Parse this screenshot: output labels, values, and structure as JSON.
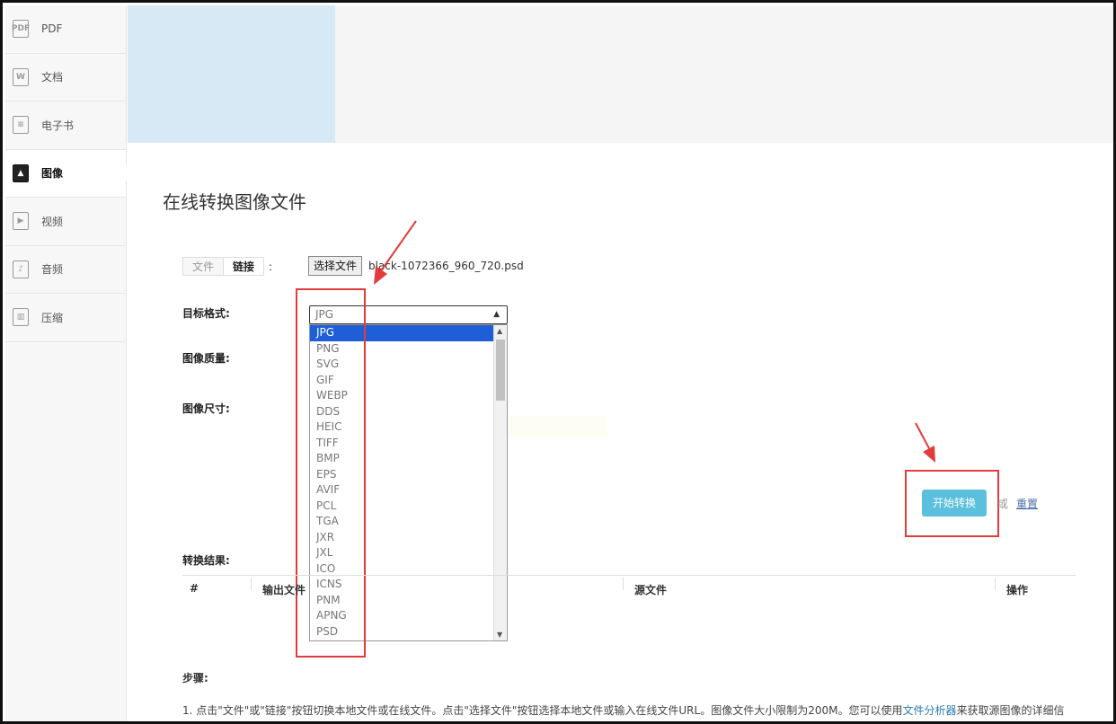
{
  "sidebar": {
    "items": [
      {
        "label": "PDF",
        "icon": "pdf-file-icon",
        "glyph": "PDF"
      },
      {
        "label": "文档",
        "icon": "word-file-icon",
        "glyph": "W"
      },
      {
        "label": "电子书",
        "icon": "ebook-icon",
        "glyph": "≡"
      },
      {
        "label": "图像",
        "icon": "image-icon",
        "glyph": "▲",
        "active": true
      },
      {
        "label": "视频",
        "icon": "video-icon",
        "glyph": "▶"
      },
      {
        "label": "音频",
        "icon": "audio-icon",
        "glyph": "♪"
      },
      {
        "label": "压缩",
        "icon": "archive-icon",
        "glyph": "▥"
      }
    ]
  },
  "page": {
    "title": "在线转换图像文件"
  },
  "source": {
    "tab_file": "文件",
    "tab_link": "链接",
    "colon": ":",
    "choose_button": "选择文件",
    "file_name": "black-1072366_960_720.psd"
  },
  "form": {
    "target_format_label": "目标格式:",
    "quality_label": "图像质量:",
    "size_label": "图像尺寸:",
    "selected_format": "JPG",
    "format_options": [
      "JPG",
      "PNG",
      "SVG",
      "GIF",
      "WEBP",
      "DDS",
      "HEIC",
      "TIFF",
      "BMP",
      "EPS",
      "AVIF",
      "PCL",
      "TGA",
      "JXR",
      "JXL",
      "ICO",
      "ICNS",
      "PNM",
      "APNG",
      "PSD"
    ]
  },
  "actions": {
    "start_button": "开始转换",
    "or_text": "或",
    "reset_link": "重置"
  },
  "results": {
    "label": "转换结果:",
    "columns": [
      "#",
      "输出文件",
      "源文件",
      "操作"
    ]
  },
  "steps": {
    "label": "步骤:",
    "step1_text": "1. 点击\"文件\"或\"链接\"按钮切换本地文件或在线文件。点击\"选择文件\"按钮选择本地文件或输入在线文件URL。图像文件大小限制为200M。您可以使用",
    "step1_link": "文件分析器",
    "step1_tail": "来获取源图像的详细信"
  },
  "colors": {
    "accent": "#5bc0de",
    "highlight": "#1e5fd8",
    "annotation": "#e23b3b"
  }
}
